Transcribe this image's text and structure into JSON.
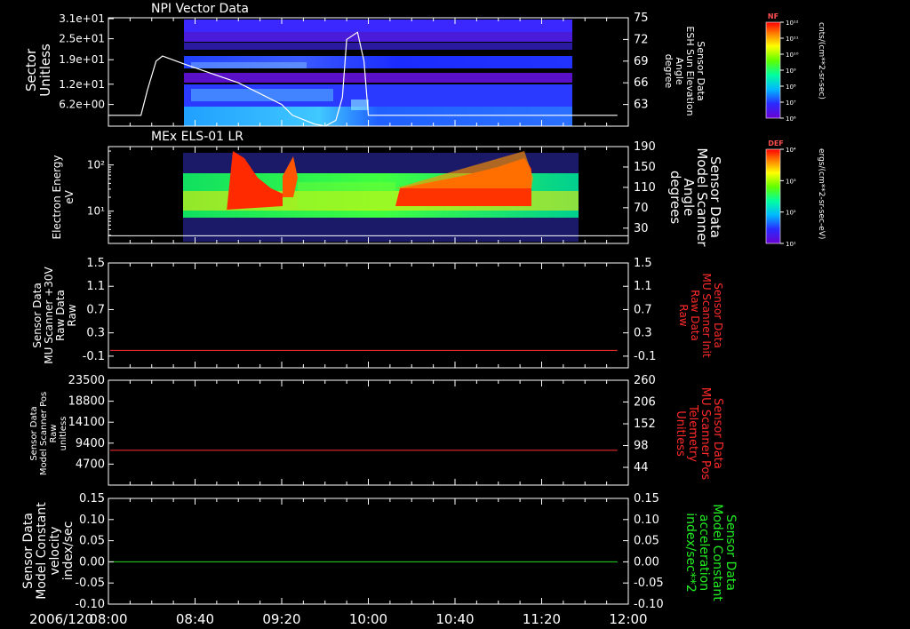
{
  "date_label": "2006/120",
  "x_ticks": [
    "08:00",
    "08:40",
    "09:20",
    "10:00",
    "10:40",
    "11:20",
    "12:00"
  ],
  "colors": {
    "axis": "#ffffff",
    "red_line": "#ff3030",
    "green_line": "#22dd22",
    "red_text": "#ff2a2a",
    "green_text": "#22ee22"
  },
  "colorbars": [
    {
      "tag": "NF",
      "unit_label": "cnts/(cm**2-sr-sec)",
      "tick_labels": [
        "10¹²",
        "10¹¹",
        "10¹⁰",
        "10⁹",
        "10⁸",
        "10⁷",
        "10⁶"
      ]
    },
    {
      "tag": "DEF",
      "unit_label": "ergs/(cm**2-sr-sec-eV)",
      "tick_labels": [
        "10⁴",
        "10³",
        "10²",
        "10¹"
      ]
    }
  ],
  "chart_data": [
    {
      "type": "heatmap",
      "title": "NPI Vector Data",
      "ylabel_lines": [
        "Sector",
        "Unitless"
      ],
      "yticks": [
        "3.1e+01",
        "2.5e+01",
        "1.9e+01",
        "1.2e+01",
        "6.2e+00"
      ],
      "ylim": [
        0,
        31
      ],
      "overlay": {
        "type": "line",
        "ylabel_lines": [
          "Sensor Data",
          "ESH Sun Elevation",
          "Angle",
          "degree"
        ],
        "yticks": [
          "75",
          "72",
          "69",
          "66",
          "63"
        ],
        "ylim": [
          60,
          75
        ],
        "x": [
          "08:00",
          "08:15",
          "08:18",
          "08:22",
          "08:25",
          "08:35",
          "09:00",
          "09:20",
          "09:25",
          "09:35",
          "09:40",
          "09:45",
          "09:48",
          "09:50",
          "09:55",
          "09:58",
          "10:00",
          "11:55"
        ],
        "y": [
          61.5,
          61.5,
          65,
          69,
          69.7,
          68.6,
          66,
          63,
          61.5,
          60.3,
          60.0,
          60.8,
          64,
          72,
          73,
          69,
          61.5,
          61.5
        ]
      },
      "data_span": [
        "08:18",
        "11:33"
      ]
    },
    {
      "type": "heatmap",
      "title": "MEx ELS-01 LR",
      "ylabel_lines": [
        "Electron Energy",
        "eV"
      ],
      "yticks": [
        "10²",
        "10¹"
      ],
      "scale": "log",
      "right_ylabel_lines": [
        "Sensor Data",
        "Model Scanner",
        "Angle",
        "degrees"
      ],
      "right_yticks": [
        "190",
        "150",
        "110",
        "70",
        "30"
      ],
      "right_ylim": [
        0,
        190
      ],
      "overlay_value": 15,
      "data_span": [
        "08:18",
        "11:35"
      ]
    },
    {
      "type": "line",
      "ylabel_lines": [
        "Sensor Data",
        "MU Scanner +30V",
        "Raw Data",
        "Raw"
      ],
      "yticks": [
        "1.5",
        "1.1",
        "0.7",
        "0.3",
        "-0.1"
      ],
      "ylim": [
        -0.3,
        1.5
      ],
      "right_ylabel_lines": [
        "Sensor Data",
        "MU Scanner Init",
        "Raw Data",
        "Raw"
      ],
      "right_yticks": [
        "1.5",
        "1.1",
        "0.7",
        "0.3",
        "-0.1"
      ],
      "series": [
        {
          "x": [
            "08:00",
            "11:55"
          ],
          "y": [
            0.0,
            0.0
          ],
          "color": "red"
        }
      ]
    },
    {
      "type": "line",
      "ylabel_lines": [
        "Sensor Data",
        "Model Scanner Pos",
        "Raw",
        "unitless"
      ],
      "yticks": [
        "23500",
        "18800",
        "14100",
        "9400",
        "4700"
      ],
      "ylim": [
        0,
        23500
      ],
      "right_ylabel_lines": [
        "Sensor Data",
        "MU Scanner Pos",
        "Telemetry",
        "Unitless"
      ],
      "right_yticks": [
        "260",
        "206",
        "152",
        "98",
        "44"
      ],
      "right_ylim": [
        0,
        260
      ],
      "series": [
        {
          "x": [
            "08:00",
            "11:55"
          ],
          "y": [
            7800,
            7800
          ],
          "color": "red"
        }
      ]
    },
    {
      "type": "line",
      "ylabel_lines": [
        "Sensor Data",
        "Model Constant",
        "velocity",
        "index/sec"
      ],
      "yticks": [
        "0.15",
        "0.10",
        "0.05",
        "0.00",
        "-0.05",
        "-0.10"
      ],
      "ylim": [
        -0.1,
        0.15
      ],
      "right_ylabel_lines": [
        "Sensor Data",
        "Model Constant",
        "acceleration",
        "index/sec**2"
      ],
      "right_yticks": [
        "0.15",
        "0.10",
        "0.05",
        "0.00",
        "-0.05",
        "-0.10"
      ],
      "series": [
        {
          "x": [
            "08:00",
            "11:55"
          ],
          "y": [
            0.0,
            0.0
          ],
          "color": "green"
        }
      ]
    }
  ]
}
